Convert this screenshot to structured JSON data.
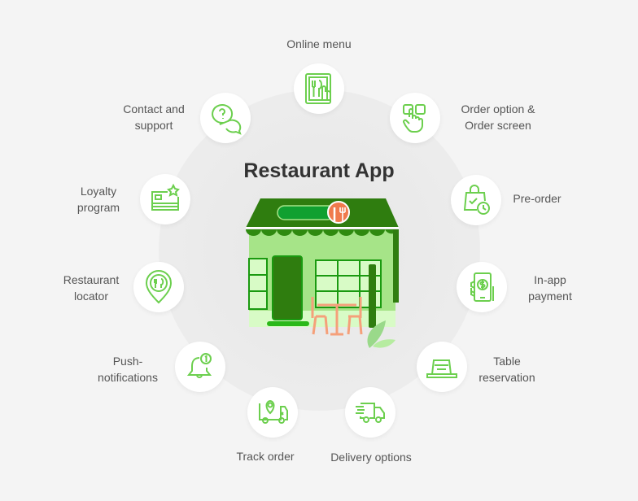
{
  "title": "Restaurant App",
  "colors": {
    "icon_green": "#6ccf4e",
    "dark_green": "#2f7d0f",
    "light_green": "#a6e488",
    "chair": "#f5a07a"
  },
  "features": [
    {
      "id": "online-menu",
      "label": "Online menu",
      "icon": "menu-tablet-icon"
    },
    {
      "id": "order-option",
      "label_line1": "Order option &",
      "label_line2": "Order screen",
      "icon": "touch-select-icon"
    },
    {
      "id": "pre-order",
      "label": "Pre-order",
      "icon": "bag-clock-icon"
    },
    {
      "id": "in-app-payment",
      "label_line1": "In-app",
      "label_line2": "payment",
      "icon": "phone-payment-icon"
    },
    {
      "id": "table-reservation",
      "label_line1": "Table",
      "label_line2": "reservation",
      "icon": "reserved-sign-icon"
    },
    {
      "id": "delivery-options",
      "label": "Delivery options",
      "icon": "delivery-truck-icon"
    },
    {
      "id": "track-order",
      "label": "Track order",
      "icon": "truck-location-icon"
    },
    {
      "id": "push-notifications",
      "label_line1": "Push-",
      "label_line2": "notifications",
      "icon": "bell-notification-icon"
    },
    {
      "id": "restaurant-locator",
      "label_line1": "Restaurant",
      "label_line2": "locator",
      "icon": "location-pin-icon"
    },
    {
      "id": "loyalty-program",
      "label_line1": "Loyalty",
      "label_line2": "program",
      "icon": "card-star-icon"
    },
    {
      "id": "contact-support",
      "label_line1": "Contact and",
      "label_line2": "support",
      "icon": "chat-question-icon"
    }
  ]
}
